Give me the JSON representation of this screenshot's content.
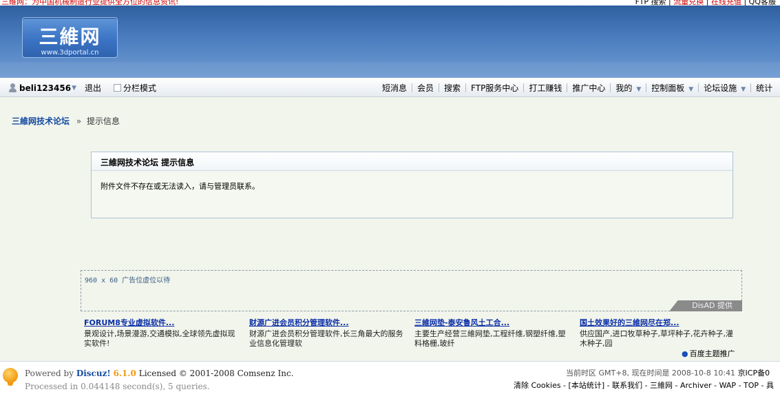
{
  "topbar": {
    "left_text": "三維网：为中国机械制造行业提供全方位的信息资讯!",
    "right_items": [
      "FTP 搜索",
      "流量兑换",
      "在线充值",
      "QQ客服"
    ]
  },
  "header": {
    "logo_main": "三維网",
    "logo_url": "www.3dportal.cn"
  },
  "nav": {
    "username": "beli123456",
    "logout": "退出",
    "split_mode": "分栏模式",
    "items": [
      "短消息",
      "会员",
      "搜索",
      "FTP服务中心",
      "打工赚钱",
      "推广中心",
      "我的",
      "控制面板",
      "论坛设施",
      "统计"
    ]
  },
  "breadcrumb": {
    "home": "三維网技术论坛",
    "separator": "»",
    "current": "提示信息"
  },
  "message": {
    "title": "三維网技术论坛  提示信息",
    "body": "附件文件不存在或无法读入，请与管理员联系。"
  },
  "ad_placeholder": {
    "text": "960 x 60 广告位虚位以待",
    "provider": "DisAD 提供"
  },
  "text_ads": [
    {
      "title": "FORUM8专业虚拟软件...",
      "desc": "景观设计,场景漫游,交通模拟,全球领先虚拟现实软件!"
    },
    {
      "title": "财源广进会员积分管理软件...",
      "desc": "财源广进会员积分管理软件,长三角最大的服务业信息化管理软"
    },
    {
      "title": "三維网垫-泰安鲁风土工合...",
      "desc": "主要生产经营三維网垫,工程纤维,钢塑纤维,塑料格栅,玻纤"
    },
    {
      "title": "国土效果好的三維网尽在郑...",
      "desc": "供应国产,进口牧草种子,草坪种子,花卉种子,灌木种子,园"
    }
  ],
  "baidu_promo": "百度主题推广",
  "footer": {
    "powered_prefix": "Powered by",
    "brand": "Discuz!",
    "version": "6.1.0",
    "license": "Licensed © 2001-2008 Comsenz Inc.",
    "processed": "Processed in 0.044148 second(s), 5 queries.",
    "timezone": "当前时区  GMT+8, 现在时间是  2008-10-8 10:41",
    "icp": "京ICP备0",
    "links": "清除  Cookies - [本站统计] - 联系我们 - 三維网 - Archiver - WAP - TOP - 具"
  },
  "colors": {
    "link_blue": "#154ba0",
    "header_blue": "#3b74c4",
    "accent_orange": "#f29a12",
    "alert_red": "#c00000"
  }
}
